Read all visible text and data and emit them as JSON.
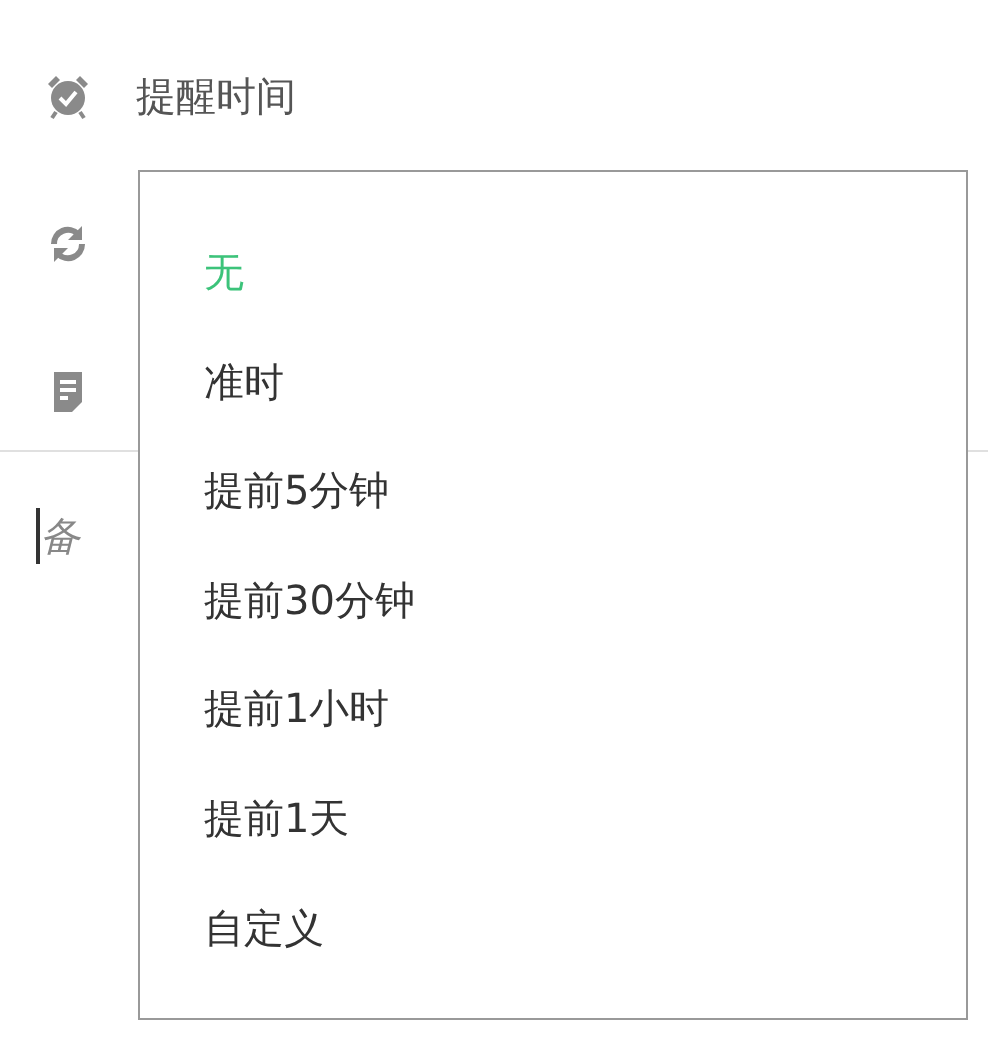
{
  "fields": [
    {
      "kind": "alarm",
      "label": "提醒时间"
    },
    {
      "kind": "repeat"
    },
    {
      "kind": "note"
    }
  ],
  "note": {
    "placeholder": "备"
  },
  "dropdown": {
    "options": [
      {
        "label": "无",
        "selected": true
      },
      {
        "label": "准时",
        "selected": false
      },
      {
        "label": "提前5分钟",
        "selected": false
      },
      {
        "label": "提前30分钟",
        "selected": false
      },
      {
        "label": "提前1小时",
        "selected": false
      },
      {
        "label": "提前1天",
        "selected": false
      },
      {
        "label": "自定义",
        "selected": false
      }
    ]
  }
}
